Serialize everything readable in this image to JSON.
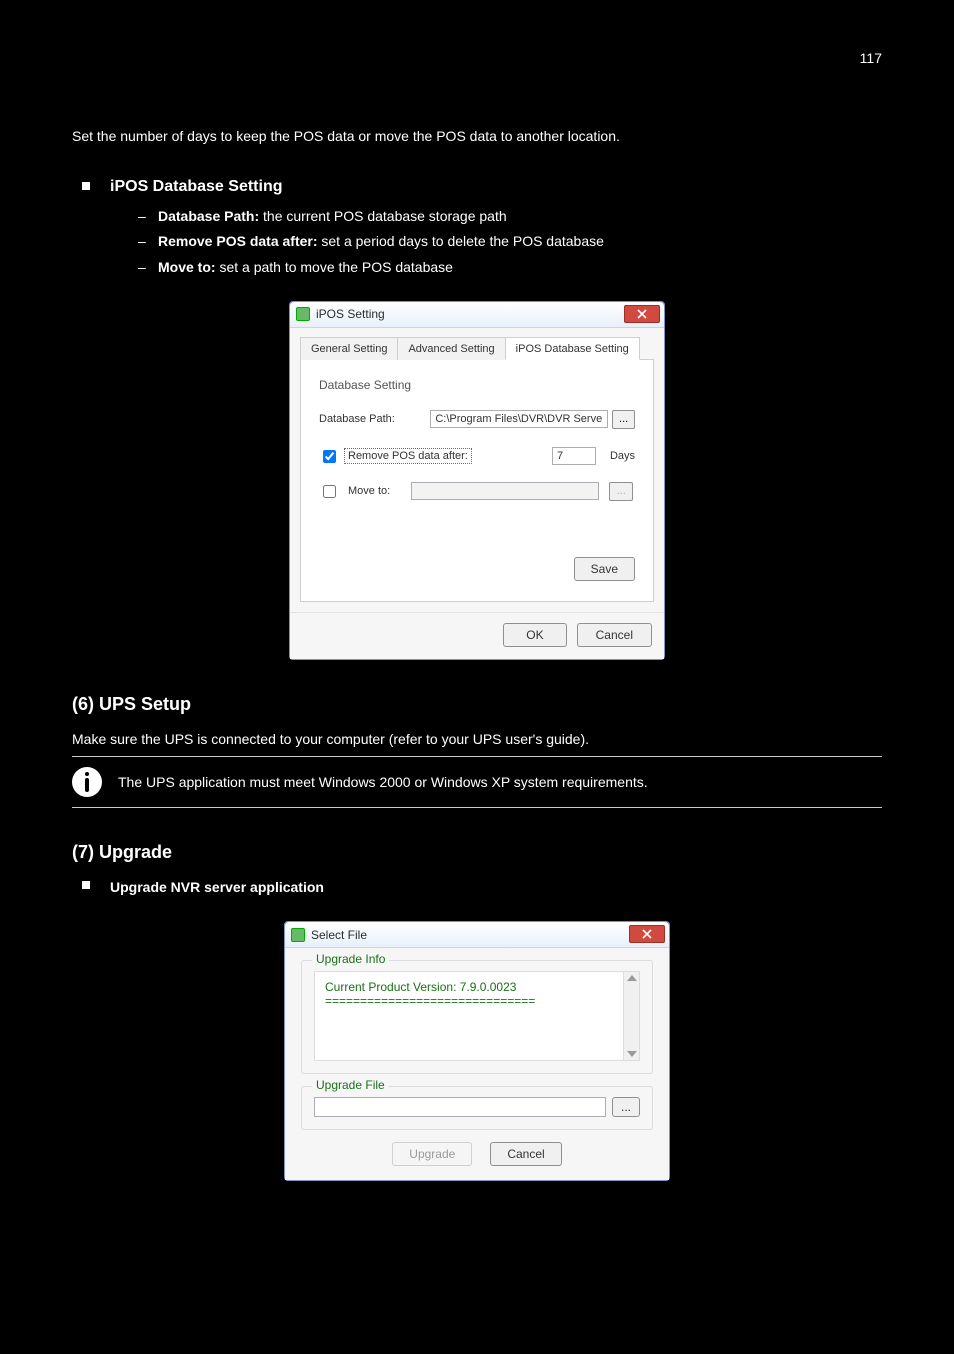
{
  "page_number": "117",
  "sections": {
    "body_para": "Set the number of days to keep the POS data or move the POS data to another location.",
    "bullet_title": "iPOS Database Setting",
    "dash1_label": "Database Path:",
    "dash1_desc": " the current POS database storage path",
    "dash2_label": "Remove POS data after:",
    "dash2_desc": " set a period days to delete the POS database",
    "dash3_label": "Move to:",
    "dash3_desc": " set a path to move the POS database"
  },
  "ipos": {
    "title": "iPOS Setting",
    "tabs": [
      "General Setting",
      "Advanced Setting",
      "iPOS Database Setting"
    ],
    "group": "Database Setting",
    "db_path_label": "Database Path:",
    "db_path_value": "C:\\Program Files\\DVR\\DVR Server\\POSDB",
    "browse": "...",
    "remove_label": "Remove POS data after:",
    "remove_days": "7",
    "days_word": "Days",
    "moveto_label": "Move to:",
    "save": "Save",
    "ok": "OK",
    "cancel": "Cancel"
  },
  "ups": {
    "heading": "(6) UPS Setup",
    "para": "Make sure the UPS is connected to your computer (refer to your UPS user's guide).",
    "note": "The UPS application must meet Windows 2000 or Windows XP system requirements."
  },
  "upgrade": {
    "heading": "(7) Upgrade",
    "bullet": "Upgrade NVR server application",
    "win_title": "Select File",
    "group1": "Upgrade Info",
    "info_line1": "Current Product Version: 7.9.0.0023",
    "info_line2": "==============================",
    "group2": "Upgrade File",
    "browse": "...",
    "upgrade_btn": "Upgrade",
    "cancel_btn": "Cancel"
  }
}
